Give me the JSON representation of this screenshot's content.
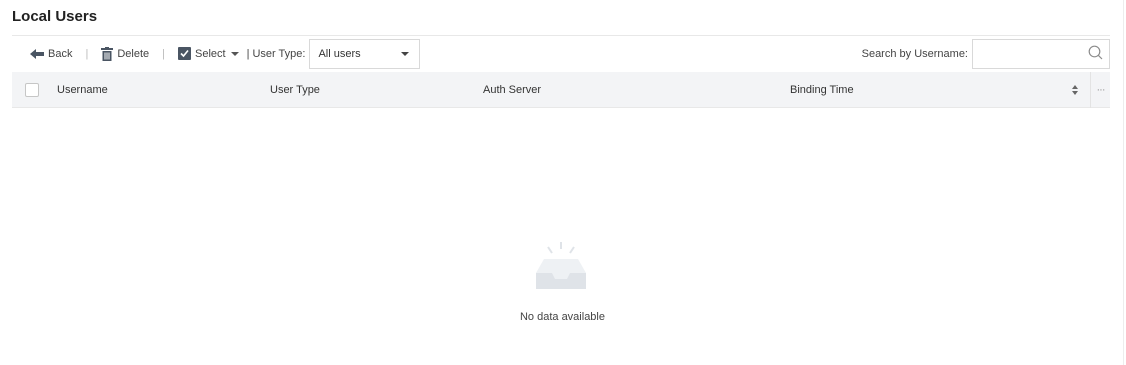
{
  "page": {
    "title": "Local Users"
  },
  "toolbar": {
    "back_label": "Back",
    "delete_label": "Delete",
    "select_label": "Select",
    "separator": "|",
    "user_type_label": "| User Type:",
    "user_type_value": "All users",
    "search_label": "Search by Username:",
    "search_value": ""
  },
  "table": {
    "columns": [
      "Username",
      "User Type",
      "Auth Server",
      "Binding Time"
    ],
    "more_glyph": "···",
    "rows": [],
    "empty_text": "No data available"
  },
  "colors": {
    "header_bg": "#f3f4f6",
    "border": "#e8e8e8",
    "icon_dark": "#4a5563",
    "empty_icon": "#dfe3e8"
  },
  "icons": {
    "back": "back-arrow-icon",
    "delete": "trash-icon",
    "select": "checked-box-icon",
    "search": "search-icon",
    "sort": "sort-icon",
    "more": "more-icon",
    "empty": "empty-inbox-icon"
  }
}
